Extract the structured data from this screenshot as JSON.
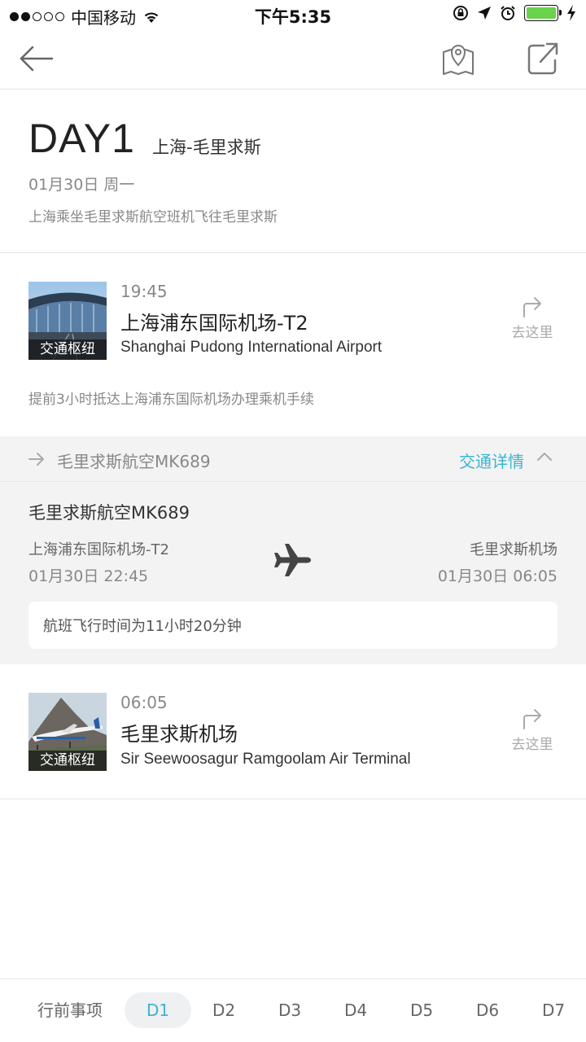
{
  "status": {
    "carrier": "中国移动",
    "time": "下午5:35"
  },
  "day": {
    "title": "DAY1",
    "route": "上海-毛里求斯",
    "date": "01月30日 周一",
    "desc": "上海乘坐毛里求斯航空班机飞往毛里求斯"
  },
  "origin": {
    "tag": "交通枢纽",
    "time": "19:45",
    "name": "上海浦东国际机场-T2",
    "name_en": "Shanghai Pudong International Airport",
    "goto": "去这里",
    "tip": "提前3小时抵达上海浦东国际机场办理乘机手续"
  },
  "transport": {
    "name": "毛里求斯航空MK689",
    "detail": "交通详情"
  },
  "flight": {
    "name": "毛里求斯航空MK689",
    "from": "上海浦东国际机场-T2",
    "from_time": "01月30日 22:45",
    "to": "毛里求斯机场",
    "to_time": "01月30日 06:05",
    "duration": "航班飞行时间为11小时20分钟"
  },
  "destination": {
    "tag": "交通枢纽",
    "time": "06:05",
    "name": "毛里求斯机场",
    "name_en": "Sir Seewoosagur Ramgoolam Air Terminal",
    "goto": "去这里"
  },
  "tabs": [
    "行前事项",
    "D1",
    "D2",
    "D3",
    "D4",
    "D5",
    "D6",
    "D7"
  ],
  "active_tab": "D1",
  "colors": {
    "accent": "#39b5d1",
    "battery": "#6ad24c"
  }
}
